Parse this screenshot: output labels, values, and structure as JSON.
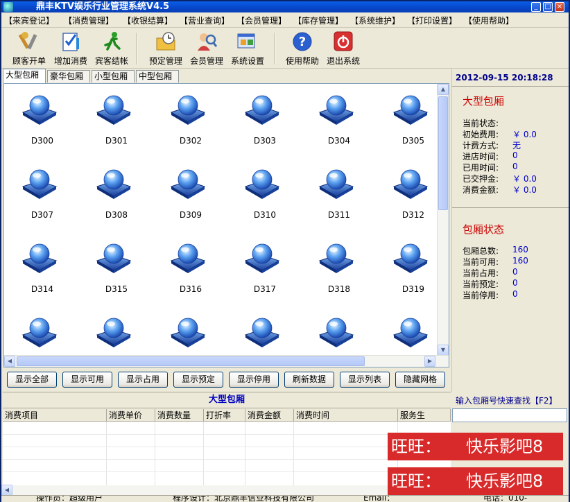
{
  "window": {
    "title": "鼎丰KTV娱乐行业管理系统V4.5",
    "minimize": "_",
    "maximize": "□",
    "close": "×"
  },
  "menu": [
    "【来宾登记】",
    "【消费管理】",
    "【收银结算】",
    "【营业查询】",
    "【会员管理】",
    "【库存管理】",
    "【系统维护】",
    "【打印设置】",
    "【使用帮助】"
  ],
  "toolbar": [
    {
      "label": "顾客开单",
      "icon": "tools-icon"
    },
    {
      "label": "增加消费",
      "icon": "checklist-icon"
    },
    {
      "label": "宾客结帐",
      "icon": "running-man-icon"
    },
    {
      "label": "预定管理",
      "icon": "folder-clock-icon"
    },
    {
      "label": "会员管理",
      "icon": "member-search-icon"
    },
    {
      "label": "系统设置",
      "icon": "settings-window-icon"
    },
    {
      "label": "使用帮助",
      "icon": "help-icon"
    },
    {
      "label": "退出系统",
      "icon": "power-icon"
    }
  ],
  "tabs": [
    "大型包厢",
    "豪华包厢",
    "小型包厢",
    "中型包厢"
  ],
  "active_tab": "大型包厢",
  "rooms": [
    "D300",
    "D301",
    "D302",
    "D303",
    "D304",
    "D305",
    "D307",
    "D308",
    "D309",
    "D310",
    "D311",
    "D312",
    "D314",
    "D315",
    "D316",
    "D317",
    "D318",
    "D319",
    "",
    "",
    "",
    "",
    "",
    ""
  ],
  "buttons": [
    "显示全部",
    "显示可用",
    "显示占用",
    "显示预定",
    "显示停用",
    "刷新数据",
    "显示列表",
    "隐藏网格"
  ],
  "datetime": "2012-09-15 20:18:28",
  "room_panel": {
    "title": "大型包厢",
    "items": [
      {
        "k": "当前状态:",
        "v": ""
      },
      {
        "k": "初始费用:",
        "v": "￥ 0.0"
      },
      {
        "k": "计费方式:",
        "v": "无"
      },
      {
        "k": "进店时间:",
        "v": "0"
      },
      {
        "k": "已用时间:",
        "v": "0"
      },
      {
        "k": "已交押金:",
        "v": "￥ 0.0"
      },
      {
        "k": "消费金额:",
        "v": "￥ 0.0"
      }
    ]
  },
  "status_panel": {
    "title": "包厢状态",
    "items": [
      {
        "k": "包厢总数:",
        "v": "160"
      },
      {
        "k": "当前可用:",
        "v": "160"
      },
      {
        "k": "当前占用:",
        "v": "0"
      },
      {
        "k": "当前预定:",
        "v": "0"
      },
      {
        "k": "当前停用:",
        "v": "0"
      }
    ]
  },
  "detail_header": "大型包厢",
  "quick_search": "输入包厢号快速查找【F2】",
  "table_headers": [
    "消费项目",
    "消费单价",
    "消费数量",
    "打折率",
    "消费金额",
    "消费时间",
    "",
    "服务生"
  ],
  "ads": [
    {
      "a": "旺旺：",
      "b": "快乐影吧8"
    },
    {
      "a": "旺旺：",
      "b": "快乐影吧8"
    }
  ],
  "statusbar": [
    "操作员：超级用户",
    "程序设计：北京鼎丰信业科技有限公司",
    "Email：",
    "电话：010-"
  ],
  "colors": {
    "accent": "#0000c0",
    "panel_title": "#cc0000",
    "value": "#0000cc",
    "ad": "#d82a2a"
  }
}
